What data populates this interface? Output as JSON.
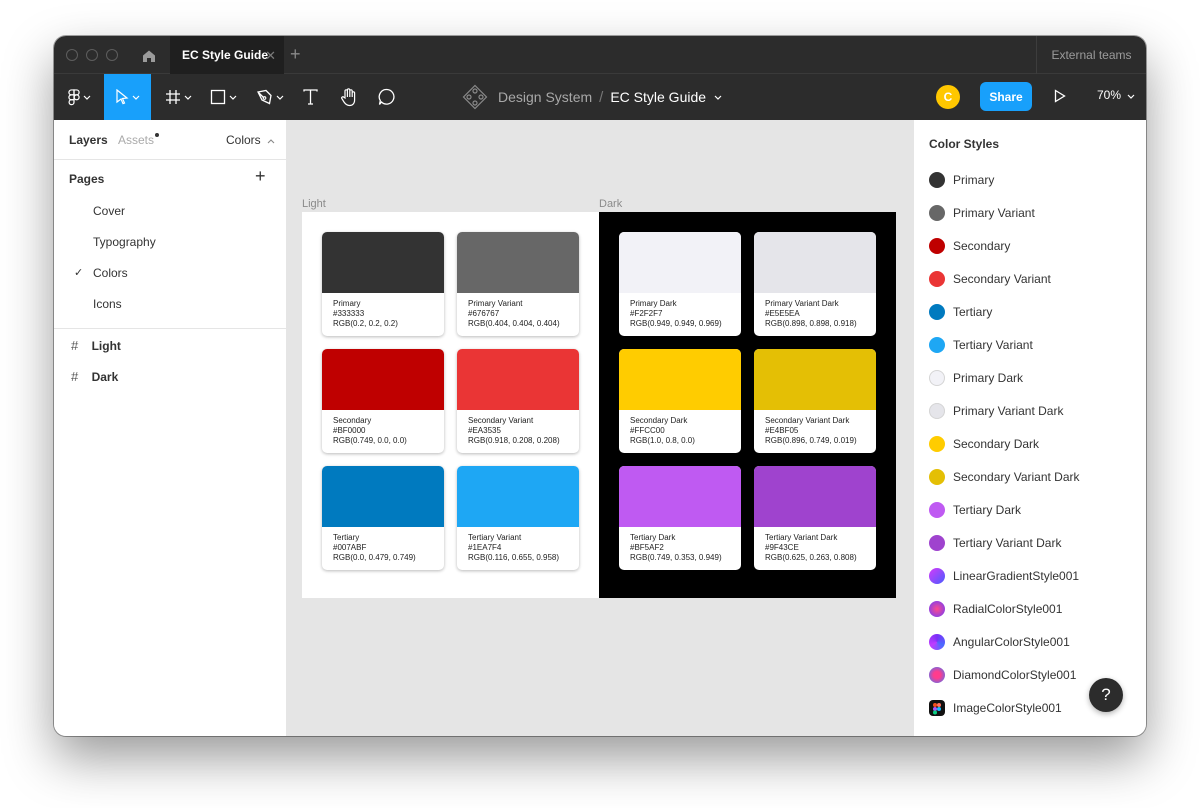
{
  "titlebar": {
    "tab_title": "EC Style Guide",
    "tab_close": "✕",
    "tab_add": "+",
    "external_teams": "External teams"
  },
  "toolbar": {
    "breadcrumb_parent": "Design System",
    "breadcrumb_sep": "/",
    "breadcrumb_file": "EC Style Guide",
    "avatar_initial": "C",
    "share_label": "Share",
    "zoom_label": "70%"
  },
  "left_panel": {
    "tab_layers": "Layers",
    "tab_assets": "Assets",
    "page_selector": "Colors",
    "pages_heading": "Pages",
    "pages_add": "+",
    "pages": [
      "Cover",
      "Typography",
      "Colors",
      "Icons"
    ],
    "current_page_check": "✓",
    "layers": [
      "Light",
      "Dark"
    ],
    "frame_glyph": "#"
  },
  "canvas": {
    "light_label": "Light",
    "dark_label": "Dark",
    "light_swatches": [
      {
        "name": "Primary",
        "hex": "#333333",
        "rgb": "RGB(0.2, 0.2, 0.2)",
        "color": "#333333"
      },
      {
        "name": "Primary Variant",
        "hex": "#676767",
        "rgb": "RGB(0.404, 0.404, 0.404)",
        "color": "#676767"
      },
      {
        "name": "Secondary",
        "hex": "#BF0000",
        "rgb": "RGB(0.749, 0.0, 0.0)",
        "color": "#BF0000"
      },
      {
        "name": "Secondary Variant",
        "hex": "#EA3535",
        "rgb": "RGB(0.918, 0.208, 0.208)",
        "color": "#EA3535"
      },
      {
        "name": "Tertiary",
        "hex": "#007ABF",
        "rgb": "RGB(0.0, 0.479, 0.749)",
        "color": "#007ABF"
      },
      {
        "name": "Tertiary Variant",
        "hex": "#1EA7F4",
        "rgb": "RGB(0.116, 0.655, 0.958)",
        "color": "#1EA7F4"
      }
    ],
    "dark_swatches": [
      {
        "name": "Primary Dark",
        "hex": "#F2F2F7",
        "rgb": "RGB(0.949, 0.949, 0.969)",
        "color": "#F2F2F7"
      },
      {
        "name": "Primary Variant Dark",
        "hex": "#E5E5EA",
        "rgb": "RGB(0.898, 0.898, 0.918)",
        "color": "#E5E5EA"
      },
      {
        "name": "Secondary Dark",
        "hex": "#FFCC00",
        "rgb": "RGB(1.0, 0.8, 0.0)",
        "color": "#FFCC00"
      },
      {
        "name": "Secondary Variant Dark",
        "hex": "#E4BF05",
        "rgb": "RGB(0.896, 0.749, 0.019)",
        "color": "#E4BF05"
      },
      {
        "name": "Tertiary Dark",
        "hex": "#BF5AF2",
        "rgb": "RGB(0.749, 0.353, 0.949)",
        "color": "#BF5AF2"
      },
      {
        "name": "Tertiary Variant Dark",
        "hex": "#9F43CE",
        "rgb": "RGB(0.625, 0.263, 0.808)",
        "color": "#9F43CE"
      }
    ]
  },
  "right_panel": {
    "title": "Color Styles",
    "styles": [
      {
        "name": "Primary",
        "color": "#333333"
      },
      {
        "name": "Primary Variant",
        "color": "#676767"
      },
      {
        "name": "Secondary",
        "color": "#BF0000"
      },
      {
        "name": "Secondary Variant",
        "color": "#EA3535"
      },
      {
        "name": "Tertiary",
        "color": "#007ABF"
      },
      {
        "name": "Tertiary Variant",
        "color": "#1EA7F4"
      },
      {
        "name": "Primary Dark",
        "color": "#F2F2F7"
      },
      {
        "name": "Primary Variant Dark",
        "color": "#E5E5EA"
      },
      {
        "name": "Secondary Dark",
        "color": "#FFCC00"
      },
      {
        "name": "Secondary Variant Dark",
        "color": "#E4BF05"
      },
      {
        "name": "Tertiary Dark",
        "color": "#BF5AF2"
      },
      {
        "name": "Tertiary Variant Dark",
        "color": "#9F43CE"
      },
      {
        "name": "LinearGradientStyle001",
        "color": "linear-gradient"
      },
      {
        "name": "RadialColorStyle001",
        "color": "radial-gradient"
      },
      {
        "name": "AngularColorStyle001",
        "color": "angular-gradient"
      },
      {
        "name": "DiamondColorStyle001",
        "color": "diamond-gradient"
      },
      {
        "name": "ImageColorStyle001",
        "color": "image-fill"
      }
    ],
    "help_label": "?"
  },
  "colors": {
    "accent": "#18A0FB",
    "toolbar_bg": "#2C2C2C",
    "avatar": "#FFC700"
  }
}
